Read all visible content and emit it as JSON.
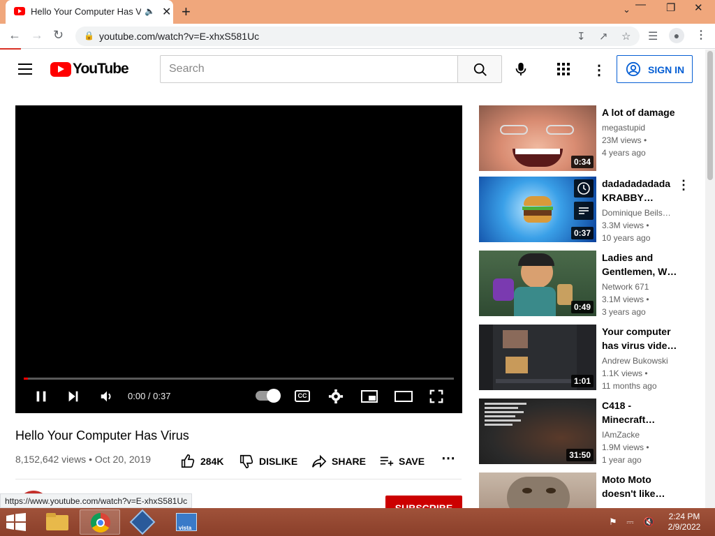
{
  "browser": {
    "tab_title": "Hello Your Computer Has Virus",
    "url": "youtube.com/watch?v=E-xhxS581Uc",
    "status_url": "https://www.youtube.com/watch?v=E-xhxS581Uc"
  },
  "youtube": {
    "logo_text": "YouTube",
    "search_placeholder": "Search",
    "signin_label": "SIGN IN"
  },
  "player": {
    "time": "0:00 / 0:37",
    "progress": 0.0
  },
  "video": {
    "title": "Hello Your Computer Has Virus",
    "meta": "8,152,642 views • Oct 20, 2019",
    "likes": "284K",
    "dislike_label": "DISLIKE",
    "share_label": "SHARE",
    "save_label": "SAVE",
    "subscribe_label": "SUBSCRIBE"
  },
  "sidebar": [
    {
      "title": "A lot of damage",
      "channel": "megastupid",
      "views": "23M views •",
      "age": "4 years ago",
      "duration": "0:34"
    },
    {
      "title": "dadadadadada KRABBY…",
      "channel": "Dominique Beils…",
      "views": "3.3M views •",
      "age": "10 years ago",
      "duration": "0:37"
    },
    {
      "title": "Ladies and Gentlemen, W…",
      "channel": "Network 671",
      "views": "3.1M views •",
      "age": "3 years ago",
      "duration": "0:49"
    },
    {
      "title": "Your computer has virus vide…",
      "channel": "Andrew Bukowski",
      "views": "1.1K views •",
      "age": "11 months ago",
      "duration": "1:01"
    },
    {
      "title": "C418 - Minecraft…",
      "channel": "IAmZacke",
      "views": "1.9M views •",
      "age": "1 year ago",
      "duration": "31:50"
    },
    {
      "title": "Moto Moto doesn't like…",
      "channel": "",
      "views": "",
      "age": "",
      "duration": ""
    }
  ],
  "taskbar": {
    "time": "2:24 PM",
    "date": "2/9/2022"
  },
  "colors": {
    "brand_red": "#ff0000",
    "link_blue": "#065fd4",
    "tabstrip": "#f0a77c",
    "taskbar": "#8a3f2a"
  }
}
